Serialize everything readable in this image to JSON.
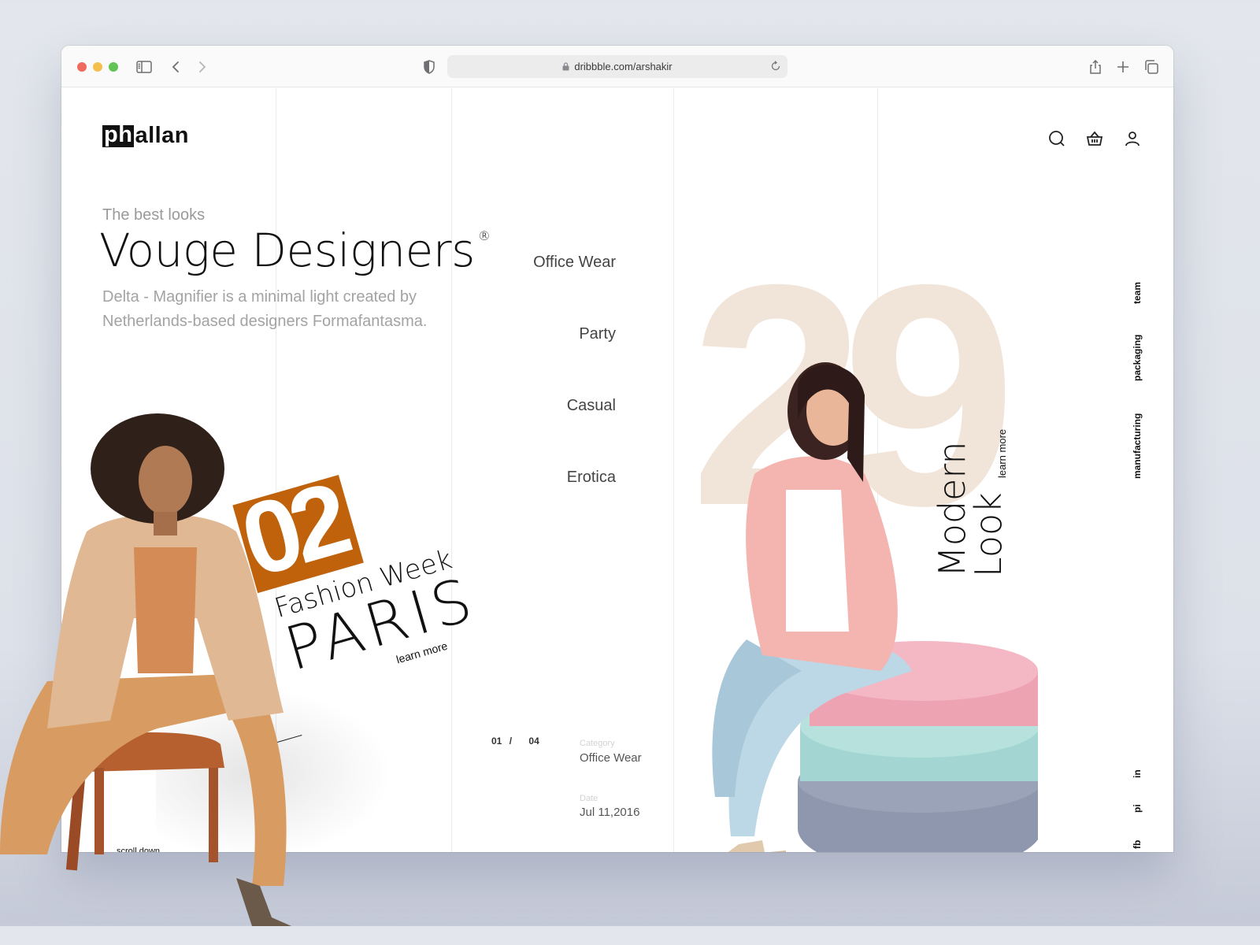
{
  "browser": {
    "url": "dribbble.com/arshakir",
    "icons": [
      "sidebar-icon",
      "back-icon",
      "forward-icon",
      "shield-icon",
      "lock-icon",
      "reload-icon",
      "share-icon",
      "new-tab-icon",
      "tabs-overview-icon"
    ]
  },
  "site": {
    "logo": {
      "inverted_part": "ph",
      "rest": "allan"
    },
    "header_icons": [
      "search-icon",
      "basket-icon",
      "user-icon"
    ]
  },
  "hero": {
    "kicker": "The best looks",
    "title": "Vouge Designers",
    "registered_mark": "®",
    "description": "Delta  - Magnifier is a minimal light created by Netherlands-based designers Formafantasma."
  },
  "categories": [
    "Office Wear",
    "Party",
    "Casual",
    "Erotica"
  ],
  "pager": {
    "current": "01",
    "separator": "/",
    "total": "04"
  },
  "meta": {
    "category_label": "Category",
    "category_value": "Office Wear",
    "date_label": "Date",
    "date_value": "Jul 11,2016"
  },
  "feature_paris": {
    "number": "02",
    "subtitle": "Fashion Week",
    "title": "PARIS",
    "link": "learn more",
    "accent_color": "#c0620c"
  },
  "feature_modern": {
    "number": "29",
    "line1": "Modern",
    "line2": "Look",
    "link": "learn more",
    "number_color": "#f1e4d9"
  },
  "side_nav": [
    "team",
    "packaging",
    "manufacturing"
  ],
  "social": [
    "in",
    "pi",
    "fb"
  ],
  "scroll_hint": "scroll down"
}
